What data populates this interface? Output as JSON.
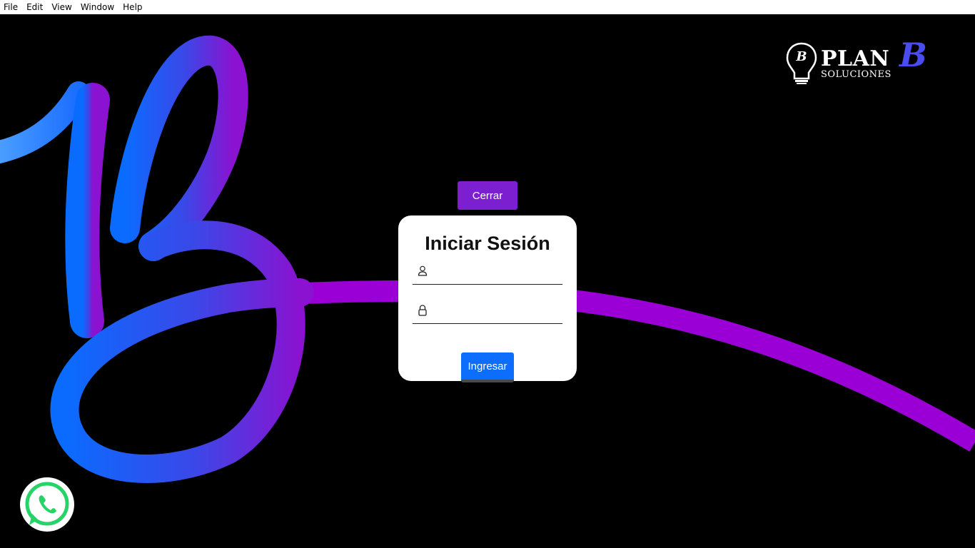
{
  "menubar": {
    "items": [
      {
        "label": "File"
      },
      {
        "label": "Edit"
      },
      {
        "label": "View"
      },
      {
        "label": "Window"
      },
      {
        "label": "Help"
      }
    ]
  },
  "brand": {
    "name": "PLAN",
    "name_accent": "B",
    "tagline": "SOLUCIONES",
    "bulb_letter": "B",
    "accent_color": "#4a4cf0"
  },
  "close_button": {
    "label": "Cerrar",
    "color": "#7b1fd0"
  },
  "login": {
    "title": "Iniciar Sesión",
    "username": {
      "value": "",
      "placeholder": "",
      "icon": "user-icon"
    },
    "password": {
      "value": "",
      "placeholder": "",
      "icon": "lock-icon"
    },
    "submit_label": "Ingresar",
    "submit_color": "#0d6efd"
  },
  "whatsapp": {
    "icon": "whatsapp-icon",
    "color": "#25d366"
  },
  "background": {
    "gradient_start": "#0a6cff",
    "gradient_end": "#8a0ad0",
    "swoosh_color": "#9a00d6"
  }
}
